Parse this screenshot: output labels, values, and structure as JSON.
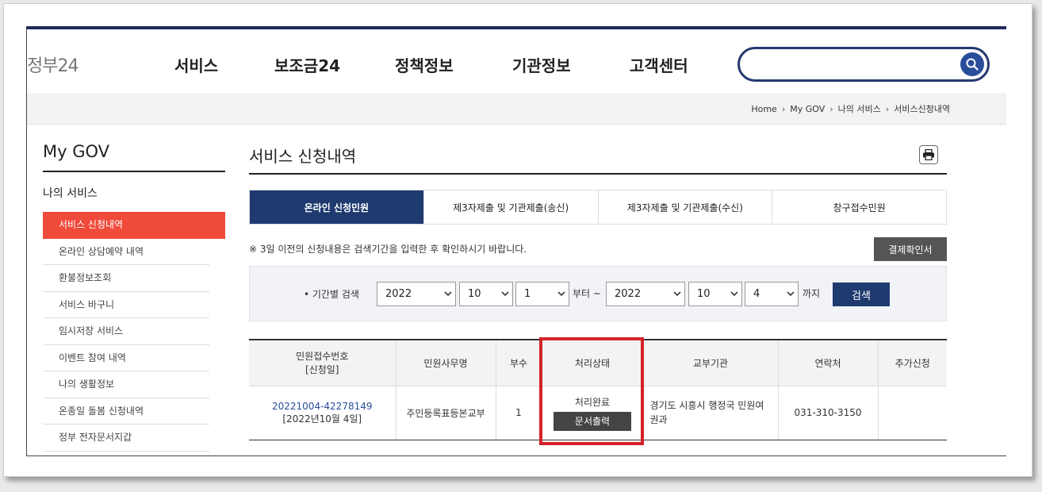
{
  "header": {
    "logo": "정부24",
    "nav": [
      "서비스",
      "보조금24",
      "정책정보",
      "기관정보",
      "고객센터"
    ],
    "search_placeholder": ""
  },
  "breadcrumb": [
    "Home",
    "My GOV",
    "나의 서비스",
    "서비스신청내역"
  ],
  "sidebar": {
    "title": "My GOV",
    "section": "나의 서비스",
    "items": [
      {
        "label": "서비스 신청내역",
        "active": true
      },
      {
        "label": "온라인 상담예약 내역"
      },
      {
        "label": "환불정보조회"
      },
      {
        "label": "서비스 바구니"
      },
      {
        "label": "임시저장 서비스"
      },
      {
        "label": "이벤트 참여 내역"
      },
      {
        "label": "나의 생활정보"
      },
      {
        "label": "온종일 돌봄 신청내역"
      },
      {
        "label": "정부 전자문서지갑"
      }
    ]
  },
  "main": {
    "title": "서비스 신청내역",
    "tabs": [
      {
        "label": "온라인 신청민원",
        "active": true
      },
      {
        "label": "제3자제출 및 기관제출(송신)"
      },
      {
        "label": "제3자제출 및 기관제출(수신)"
      },
      {
        "label": "창구접수민원"
      }
    ],
    "notice": "※ 3일 이전의 신청내용은 검색기간을 입력한 후 확인하시기 바랍니다.",
    "receipt_button": "결제확인서",
    "filter": {
      "label": "• 기간별 검색",
      "from_year": "2022",
      "from_month": "10",
      "from_day": "1",
      "from_text": "부터 ~",
      "to_year": "2022",
      "to_month": "10",
      "to_day": "4",
      "to_text": "까지",
      "search_button": "검색"
    },
    "table": {
      "headers": [
        "민원접수번호",
        "[신청일]",
        "민원사무명",
        "부수",
        "처리상태",
        "교부기관",
        "연락처",
        "추가신청"
      ],
      "row": {
        "receipt_no": "20221004-42278149",
        "date": "[2022년10월 4일]",
        "name": "주민등록표등본교부",
        "copies": "1",
        "status": "처리완료",
        "print_button": "문서출력",
        "agency": "경기도 시흥시 행정국 민원여권과",
        "contact": "031-310-3150",
        "extra": ""
      }
    }
  },
  "colors": {
    "accent": "#1e3a6f",
    "sidebar_active": "#f04a3a",
    "highlight": "#d3222a"
  }
}
